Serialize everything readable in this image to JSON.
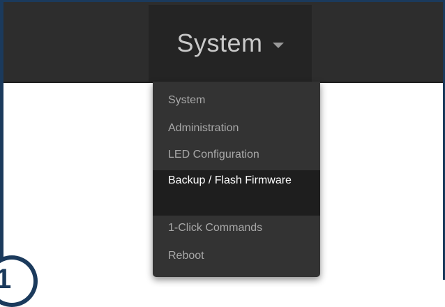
{
  "navbar": {
    "menu_label": "System",
    "caret_icon": "caret-down-icon"
  },
  "dropdown": {
    "items": [
      {
        "label": "System",
        "active": false
      },
      {
        "label": "Administration",
        "active": false
      },
      {
        "label": "LED Configuration",
        "active": false
      },
      {
        "label": "Backup / Flash Firmware",
        "active": true
      },
      {
        "label": "1-Click Commands",
        "active": false
      },
      {
        "label": "Reboot",
        "active": false
      }
    ]
  },
  "step_marker": {
    "number": "1"
  },
  "colors": {
    "navbar_bg": "#2d2d2d",
    "dropdown_bg": "#333333",
    "active_item_bg": "#1e1e1e",
    "frame_border": "#1b3a5c"
  }
}
